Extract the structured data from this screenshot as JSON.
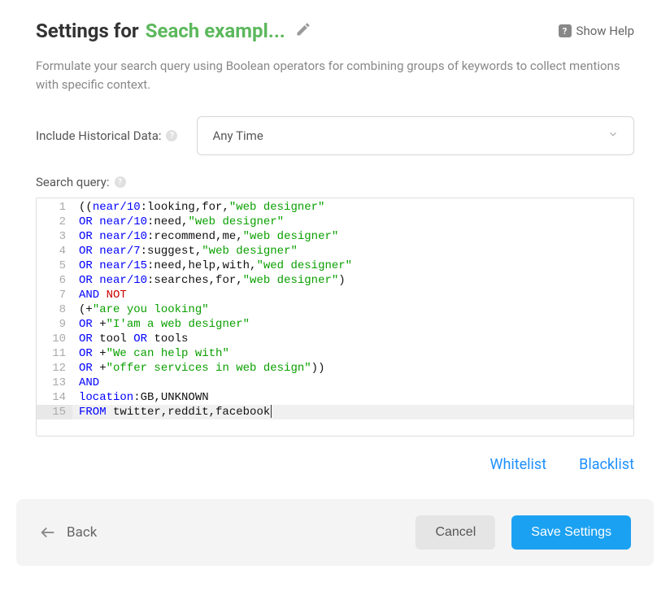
{
  "header": {
    "title_prefix": "Settings for",
    "search_name": "Seach exampl...",
    "show_help_label": "Show Help"
  },
  "description": "Formulate your search query using Boolean operators for combining groups of keywords to collect mentions with specific context.",
  "fields": {
    "historical_label": "Include Historical Data:",
    "historical_value": "Any Time",
    "query_label": "Search query:"
  },
  "editor": {
    "lines": [
      {
        "n": 1,
        "tokens": [
          {
            "t": "((",
            "c": "word"
          },
          {
            "t": "near/10",
            "c": "kw"
          },
          {
            "t": ":looking,for,",
            "c": "word"
          },
          {
            "t": "\"web designer\"",
            "c": "str"
          }
        ]
      },
      {
        "n": 2,
        "tokens": [
          {
            "t": "OR",
            "c": "kw"
          },
          {
            "t": " ",
            "c": "word"
          },
          {
            "t": "near/10",
            "c": "kw"
          },
          {
            "t": ":need,",
            "c": "word"
          },
          {
            "t": "\"web designer\"",
            "c": "str"
          }
        ]
      },
      {
        "n": 3,
        "tokens": [
          {
            "t": "OR",
            "c": "kw"
          },
          {
            "t": " ",
            "c": "word"
          },
          {
            "t": "near/10",
            "c": "kw"
          },
          {
            "t": ":recommend,me,",
            "c": "word"
          },
          {
            "t": "\"web designer\"",
            "c": "str"
          }
        ]
      },
      {
        "n": 4,
        "tokens": [
          {
            "t": "OR",
            "c": "kw"
          },
          {
            "t": " ",
            "c": "word"
          },
          {
            "t": "near/7",
            "c": "kw"
          },
          {
            "t": ":suggest,",
            "c": "word"
          },
          {
            "t": "\"web designer\"",
            "c": "str"
          }
        ]
      },
      {
        "n": 5,
        "tokens": [
          {
            "t": "OR",
            "c": "kw"
          },
          {
            "t": " ",
            "c": "word"
          },
          {
            "t": "near/15",
            "c": "kw"
          },
          {
            "t": ":need,help,with,",
            "c": "word"
          },
          {
            "t": "\"wed designer\"",
            "c": "str"
          }
        ]
      },
      {
        "n": 6,
        "tokens": [
          {
            "t": "OR",
            "c": "kw"
          },
          {
            "t": " ",
            "c": "word"
          },
          {
            "t": "near/10",
            "c": "kw"
          },
          {
            "t": ":searches,for,",
            "c": "word"
          },
          {
            "t": "\"web designer\"",
            "c": "str"
          },
          {
            "t": ")",
            "c": "word"
          }
        ]
      },
      {
        "n": 7,
        "tokens": [
          {
            "t": "AND",
            "c": "kw"
          },
          {
            "t": " ",
            "c": "word"
          },
          {
            "t": "NOT",
            "c": "not"
          }
        ]
      },
      {
        "n": 8,
        "tokens": [
          {
            "t": "(+",
            "c": "word"
          },
          {
            "t": "\"are you looking\"",
            "c": "str"
          }
        ]
      },
      {
        "n": 9,
        "tokens": [
          {
            "t": "OR",
            "c": "kw"
          },
          {
            "t": " +",
            "c": "word"
          },
          {
            "t": "\"I'am a web designer\"",
            "c": "str"
          }
        ]
      },
      {
        "n": 10,
        "tokens": [
          {
            "t": "OR",
            "c": "kw"
          },
          {
            "t": " tool ",
            "c": "word"
          },
          {
            "t": "OR",
            "c": "kw"
          },
          {
            "t": " tools",
            "c": "word"
          }
        ]
      },
      {
        "n": 11,
        "tokens": [
          {
            "t": "OR",
            "c": "kw"
          },
          {
            "t": " +",
            "c": "word"
          },
          {
            "t": "\"We can help with\"",
            "c": "str"
          }
        ]
      },
      {
        "n": 12,
        "tokens": [
          {
            "t": "OR",
            "c": "kw"
          },
          {
            "t": " +",
            "c": "word"
          },
          {
            "t": "\"offer services in web design\"",
            "c": "str"
          },
          {
            "t": "))",
            "c": "word"
          }
        ]
      },
      {
        "n": 13,
        "tokens": [
          {
            "t": "AND",
            "c": "kw"
          }
        ]
      },
      {
        "n": 14,
        "tokens": [
          {
            "t": "location",
            "c": "kw"
          },
          {
            "t": ":GB,UNKNOWN",
            "c": "word"
          }
        ]
      },
      {
        "n": 15,
        "active": true,
        "tokens": [
          {
            "t": "FROM",
            "c": "kw"
          },
          {
            "t": " twitter,reddit,facebook",
            "c": "word"
          }
        ]
      }
    ]
  },
  "links": {
    "whitelist": "Whitelist",
    "blacklist": "Blacklist"
  },
  "footer": {
    "back": "Back",
    "cancel": "Cancel",
    "save": "Save Settings"
  }
}
